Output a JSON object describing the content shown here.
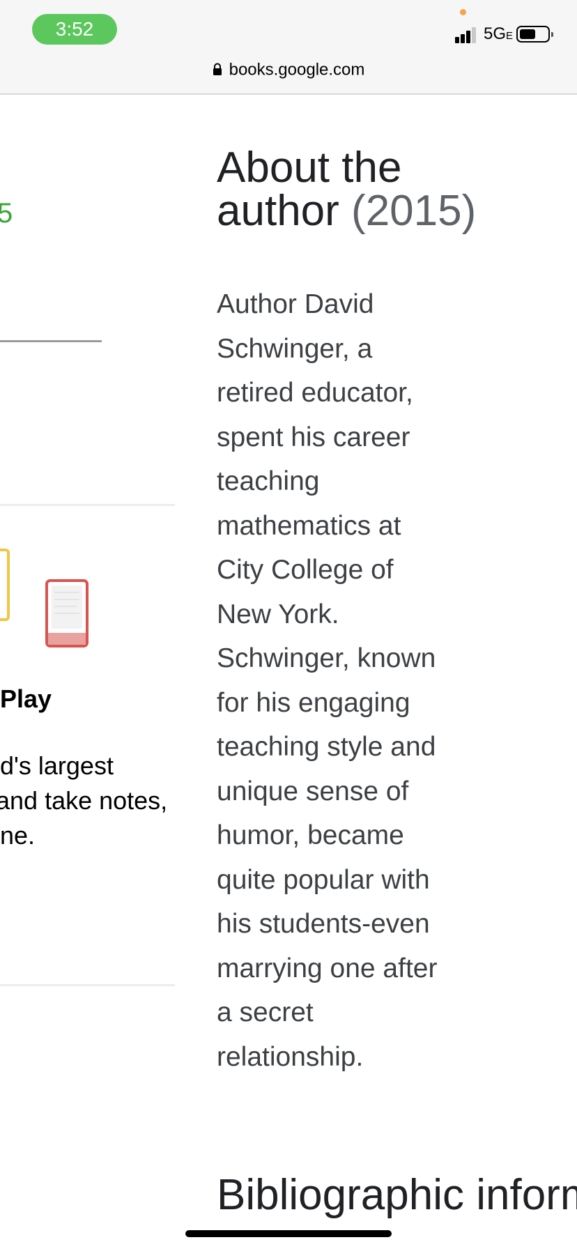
{
  "status_bar": {
    "time": "3:52",
    "network": "5G",
    "network_suffix": "E",
    "colors": {
      "time_pill": "#5cc75c",
      "mic_dot": "#f5a34c"
    }
  },
  "url_bar": {
    "url": "books.google.com"
  },
  "left_column": {
    "rating_fragment": "5",
    "play_title": "Play",
    "play_desc_lines": [
      "d's largest",
      " and take notes,",
      "ne."
    ]
  },
  "about": {
    "heading_line1": "About the",
    "heading_line2": "author",
    "year": "(2015)",
    "body_lines": [
      "Author David",
      "Schwinger, a",
      "retired educator,",
      "spent his career",
      "teaching",
      "mathematics at",
      "City College of",
      "New York.",
      "Schwinger, known",
      "for his engaging",
      "teaching style and",
      "unique sense of",
      "humor, became",
      "quite popular with",
      "his students-even",
      "marrying one after",
      "a secret",
      "relationship."
    ]
  },
  "bibliographic": {
    "heading": "Bibliographic information"
  },
  "icons": {
    "lock": "lock-icon",
    "signal": "cellular-signal-icon",
    "battery": "battery-icon",
    "ebook": "red-book-icon"
  }
}
